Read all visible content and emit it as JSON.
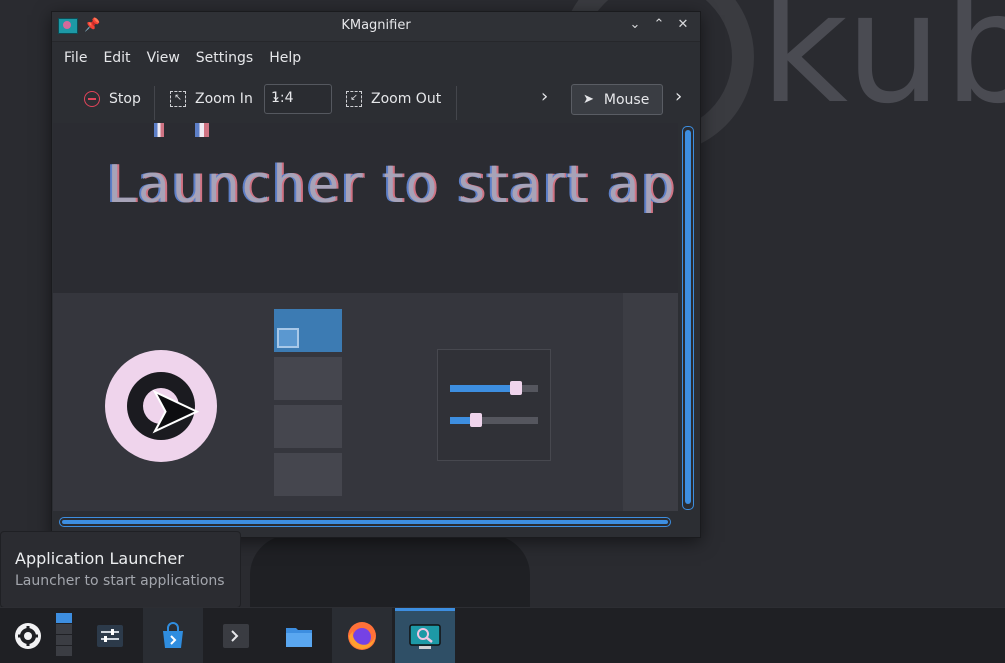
{
  "window": {
    "title": "KMagnifier",
    "controls": {
      "minimize": "⌄",
      "maximize": "⌃",
      "close": "✕"
    }
  },
  "menu": [
    "File",
    "Edit",
    "View",
    "Settings",
    "Help"
  ],
  "toolbar": {
    "stop_label": "Stop",
    "zoom_in_label": "Zoom In",
    "zoom_level": "1:4",
    "zoom_out_label": "Zoom Out",
    "mouse_label": "Mouse"
  },
  "magnified": {
    "text": "Launcher to start ap"
  },
  "wallpaper": {
    "text": "kub"
  },
  "tooltip": {
    "title": "Application Launcher",
    "subtitle": "Launcher to start applications"
  },
  "taskbar": {
    "items": [
      "application-launcher-icon",
      "system-settings-icon",
      "discover-store-icon",
      "konsole-icon",
      "dolphin-files-icon",
      "firefox-icon",
      "kmagnifier-icon"
    ]
  },
  "colors": {
    "accent": "#3d8ee0",
    "stop": "#e0445a"
  }
}
